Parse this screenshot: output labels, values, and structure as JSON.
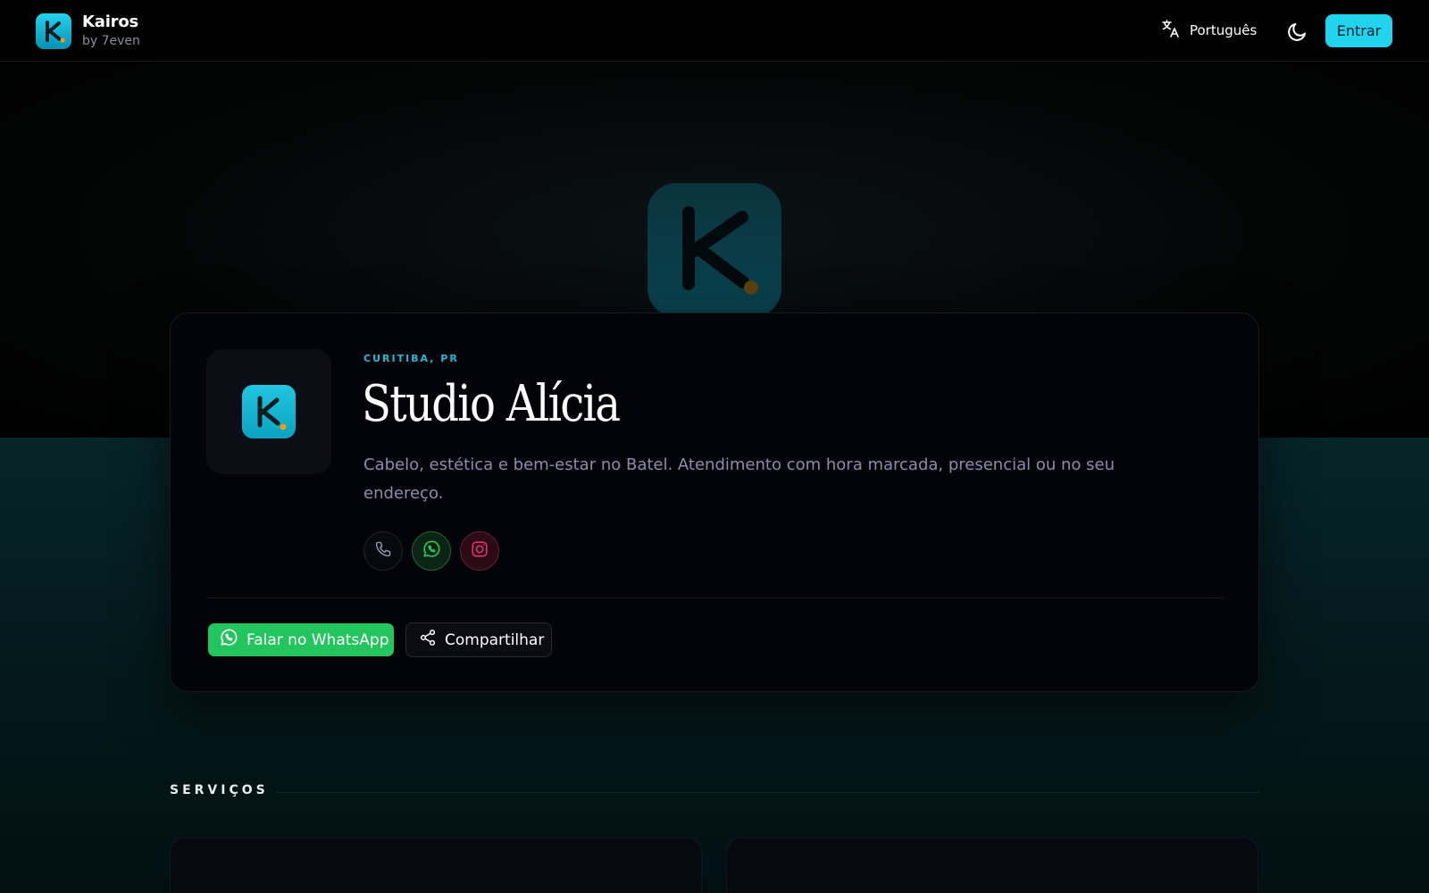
{
  "header": {
    "brand_name": "Kairos",
    "brand_by": "by 7even",
    "language_label": "Português",
    "login_label": "Entrar",
    "icons": [
      "k-logo-icon",
      "translate-icon",
      "moon-icon"
    ]
  },
  "profile": {
    "location": "CURITIBA, PR",
    "name": "Studio Alícia",
    "description": "Cabelo, estética e bem-estar no Batel. Atendimento com hora marcada, presencial ou no seu endereço.",
    "social_icons": [
      "phone-icon",
      "whatsapp-icon",
      "instagram-icon"
    ],
    "actions": {
      "whatsapp_label": "Falar no WhatsApp",
      "share_label": "Compartilhar"
    }
  },
  "services": {
    "title": "SERVIÇOS"
  },
  "colors": {
    "accent": "#22d3ee",
    "whatsapp": "#22c55e",
    "instagram": "#e1306c",
    "location_text": "#27b7d4"
  }
}
